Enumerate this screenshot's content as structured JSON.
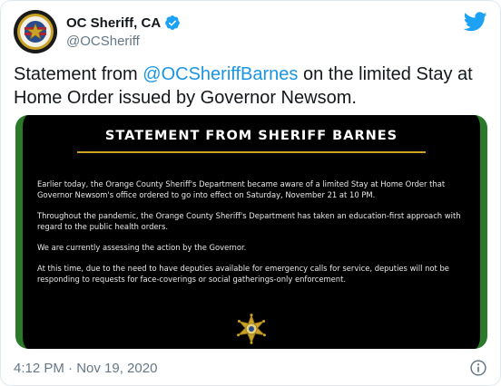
{
  "account": {
    "display_name": "OC Sheriff, CA",
    "handle": "@OCSheriff"
  },
  "tweet": {
    "text_before": "Statement from ",
    "mention": "@OCSheriffBarnes",
    "text_after": " on the limited Stay at Home Order issued by Governor Newsom."
  },
  "statement_image": {
    "title": "STATEMENT FROM SHERIFF BARNES",
    "paragraphs": [
      "Earlier today, the Orange County Sheriff's Department became aware of a limited Stay at Home Order that Governor Newsom's office ordered to go into effect on Saturday, November 21 at 10 PM.",
      "Throughout the pandemic, the Orange County Sheriff's Department has taken an education-first approach with regard to the public health orders.",
      "We are currently assessing the action by the Governor.",
      "At this time, due to the need to have deputies available for emergency calls for service, deputies will not be responding to requests for face-coverings or social gatherings-only enforcement."
    ]
  },
  "footer": {
    "timestamp": "4:12 PM · Nov 19, 2020"
  },
  "colors": {
    "twitter_blue": "#1da1f2",
    "mention_blue": "#1b95e0",
    "muted_gray": "#657786",
    "image_border_green": "#2a7a2a",
    "badge_gold": "#c9a227"
  },
  "icons": {
    "avatar": "sheriff-seal-icon",
    "verified": "verified-badge-icon",
    "brand": "twitter-bird-icon",
    "star": "sheriff-star-icon",
    "info": "info-icon"
  }
}
